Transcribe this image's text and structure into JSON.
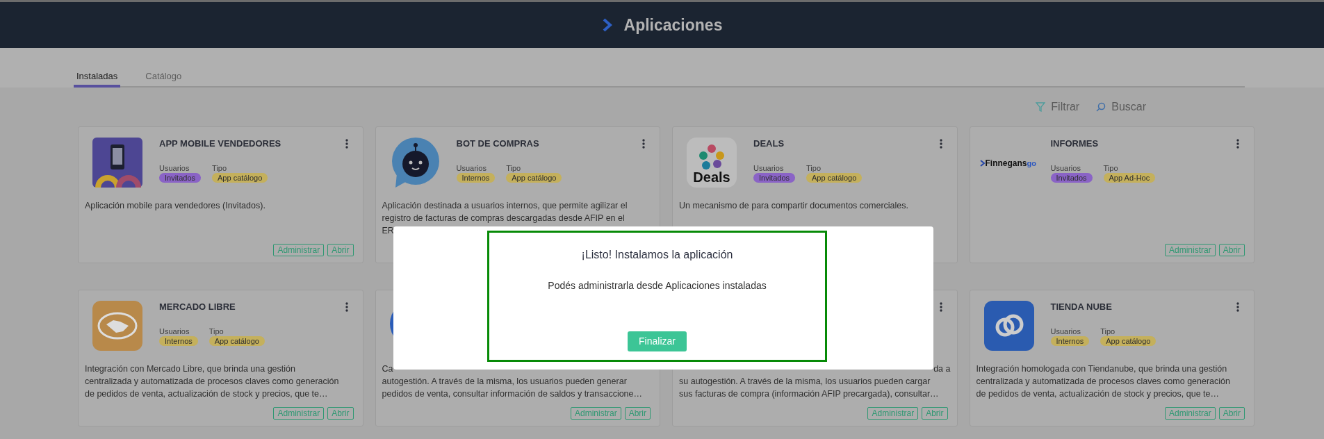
{
  "header": {
    "title": "Aplicaciones"
  },
  "tabs": [
    {
      "label": "Instaladas",
      "selected": true
    },
    {
      "label": "Catálogo",
      "selected": false
    }
  ],
  "toolbar": {
    "filter": "Filtrar",
    "search": "Buscar"
  },
  "cards": [
    {
      "title": "APP MOBILE VENDEDORES",
      "menu": true,
      "users": {
        "label": "Usuarios",
        "value": "Invitados",
        "color": "#8a63c6"
      },
      "type": {
        "label": "Tipo",
        "value": "App catálogo",
        "color": "#c4b05c"
      },
      "description_lines": [
        {
          "text": "Aplicación mobile para vendedores (Invitados).",
          "kind": "full"
        }
      ],
      "buttons": [
        "Administrar",
        "Abrir"
      ]
    },
    {
      "title": "BOT DE COMPRAS",
      "menu": true,
      "users": {
        "label": "Usuarios",
        "value": "Internos",
        "color": "#c4b05c"
      },
      "type": {
        "label": "Tipo",
        "value": "App catálogo",
        "color": "#c4b05c"
      },
      "description_lines": [
        {
          "text": "Aplicación destinada a usuarios internos, que permite agilizar el",
          "kind": "full"
        },
        {
          "text": "registro de facturas de compras descargadas desde AFIP en el",
          "kind": "full"
        },
        {
          "text": "ER",
          "kind": "full"
        }
      ]
    },
    {
      "title": "DEALS",
      "menu": true,
      "icon_text": "Deals",
      "users": {
        "label": "Usuarios",
        "value": "Invitados",
        "color": "#8a63c6"
      },
      "type": {
        "label": "Tipo",
        "value": "App catálogo",
        "color": "#c4b05c"
      },
      "description_lines": [
        {
          "text": "Un mecanismo de para compartir documentos comerciales.",
          "kind": "full"
        }
      ]
    },
    {
      "title": "INFORMES",
      "menu": true,
      "logo": {
        "text": "Finnegans",
        "suffix": "go"
      },
      "users": {
        "label": "Usuarios",
        "value": "Invitados",
        "color": "#8a63c6"
      },
      "type": {
        "label": "Tipo",
        "value": "App Ad-Hoc",
        "color": "#c4b05c"
      },
      "buttons": [
        "Administrar",
        "Abrir"
      ]
    },
    {
      "title": "MERCADO LIBRE",
      "menu": true,
      "users": {
        "label": "Usuarios",
        "value": "Internos",
        "color": "#c4b05c"
      },
      "type": {
        "label": "Tipo",
        "value": "App catálogo",
        "color": "#c4b05c"
      },
      "description_lines": [
        {
          "text": "Integración con Mercado Libre, que brinda una gestión",
          "kind": "full"
        },
        {
          "text": "centralizada y automatizada de procesos claves como generación",
          "kind": "full"
        },
        {
          "text": "de pedidos de venta, actualización de stock y precios, que te…",
          "kind": "full"
        }
      ],
      "buttons": [
        "Administrar",
        "Abrir"
      ]
    },
    {
      "menu": false,
      "description_lines": [
        {
          "text": "Ca",
          "kind": "full"
        },
        {
          "text": "autogestión. A través de la misma, los usuarios pueden generar",
          "kind": "full"
        },
        {
          "text": "pedidos de venta, consultar información de saldos y transaccione…",
          "kind": "full"
        }
      ],
      "buttons": [
        "Administrar",
        "Abrir"
      ]
    },
    {
      "menu": true,
      "description_lines": [
        {
          "text": "da a",
          "kind": "tail"
        },
        {
          "text": "su autogestión. A través de la misma, los usuarios pueden cargar",
          "kind": "full"
        },
        {
          "text": "sus facturas de compra (información AFIP precargada), consultar…",
          "kind": "full"
        }
      ],
      "buttons": [
        "Administrar",
        "Abrir"
      ]
    },
    {
      "title": "TIENDA NUBE",
      "menu": true,
      "users": {
        "label": "Usuarios",
        "value": "Internos",
        "color": "#c4b05c"
      },
      "type": {
        "label": "Tipo",
        "value": "App catálogo",
        "color": "#c4b05c"
      },
      "description_lines": [
        {
          "text": "Integración homologada con Tiendanube, que brinda una gestión",
          "kind": "full"
        },
        {
          "text": "centralizada y automatizada de procesos claves como generación",
          "kind": "full"
        },
        {
          "text": "de pedidos de venta, actualización de stock y precios, que te…",
          "kind": "full"
        }
      ],
      "buttons": [
        "Administrar",
        "Abrir"
      ]
    }
  ],
  "modal": {
    "title": "¡Listo! Instalamos la aplicación",
    "message": "Podés administrarla desde Aplicaciones instaladas",
    "button": "Finalizar"
  }
}
